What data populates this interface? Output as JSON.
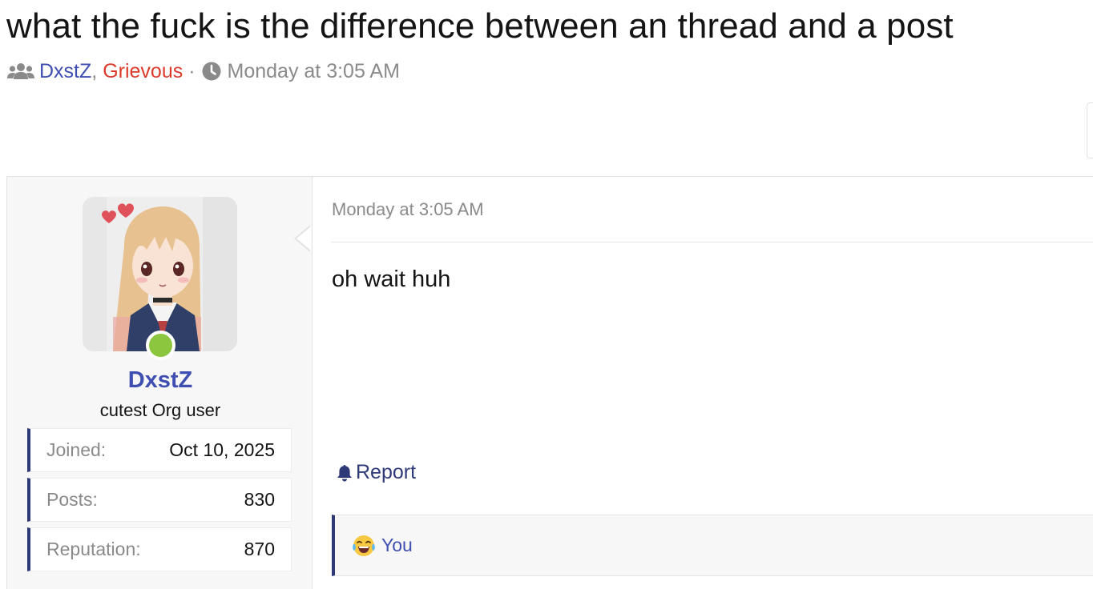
{
  "thread": {
    "title": "what the fuck is the difference between an thread and a post",
    "participants": [
      {
        "name": "DxstZ",
        "color": "#3e4fb1"
      },
      {
        "name": "Grievous",
        "color": "#dc3b2c"
      }
    ],
    "participants_separator": ",",
    "meta_separator": "·",
    "date": "Monday at 3:05 AM",
    "icons": {
      "participants": "users-icon",
      "date": "clock-icon"
    }
  },
  "post": {
    "author": {
      "username": "DxstZ",
      "user_title": "cutest Org user",
      "online": true,
      "avatar_icon": "anime-avatar-image",
      "stats": [
        {
          "label": "Joined:",
          "value": "Oct 10, 2025"
        },
        {
          "label": "Posts:",
          "value": "830"
        },
        {
          "label": "Reputation:",
          "value": "870"
        }
      ]
    },
    "date": "Monday at 3:05 AM",
    "body": "oh wait huh",
    "actions": {
      "report_label": "Report",
      "report_icon": "bell-icon"
    },
    "reactions": {
      "emoji_icon": "laughing-crying-emoji-icon",
      "label": "You"
    }
  },
  "colors": {
    "link_blue": "#3e4fb1",
    "username_red": "#dc3b2c",
    "accent_navy": "#2e3a78",
    "online_green": "#8cc63f"
  }
}
